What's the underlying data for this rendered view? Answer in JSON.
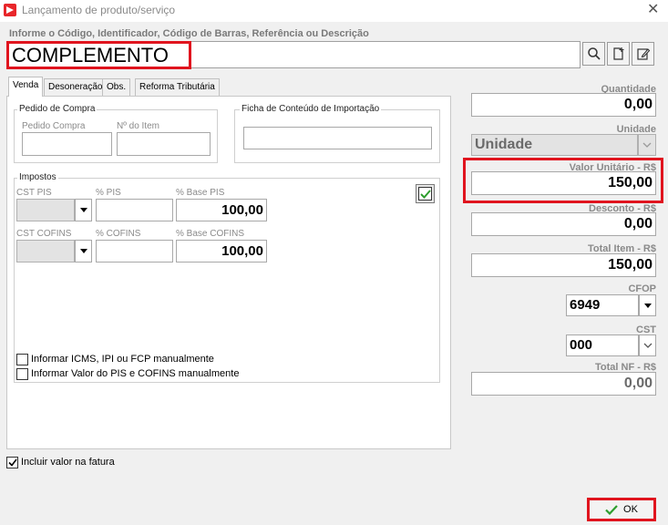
{
  "window": {
    "title": "Lançamento de produto/serviço"
  },
  "search": {
    "label": "Informe o Código, Identificador, Código de Barras, Referência ou Descrição",
    "value": "COMPLEMENTO"
  },
  "tabs": [
    {
      "label": "Venda",
      "active": true
    },
    {
      "label": "Desoneração",
      "active": false
    },
    {
      "label": "Obs.",
      "active": false
    },
    {
      "label": "Reforma Tributária",
      "active": false
    }
  ],
  "pedido_compra": {
    "title": "Pedido de Compra",
    "pedido_label": "Pedido Compra",
    "item_label": "Nº do Item",
    "pedido_value": "",
    "item_value": ""
  },
  "ficha": {
    "title": "Ficha de Conteúdo de Importação",
    "value": ""
  },
  "impostos": {
    "title": "Impostos",
    "cst_pis_label": "CST PIS",
    "pct_pis_label": "% PIS",
    "base_pis_label": "% Base PIS",
    "base_pis_value": "100,00",
    "cst_cofins_label": "CST COFINS",
    "pct_cofins_label": "% COFINS",
    "base_cofins_label": "% Base COFINS",
    "base_cofins_value": "100,00"
  },
  "checks": {
    "icms_manual": {
      "label": "Informar ICMS, IPI ou FCP manualmente",
      "checked": false
    },
    "pis_cofins_manual": {
      "label": "Informar Valor do PIS e COFINS manualmente",
      "checked": false
    },
    "incluir_fatura": {
      "label": "Incluir valor na fatura",
      "checked": true
    }
  },
  "right": {
    "quantidade_label": "Quantidade",
    "quantidade_value": "0,00",
    "unidade_label": "Unidade",
    "unidade_value": "Unidade",
    "valor_unitario_label": "Valor Unitário - R$",
    "valor_unitario_value": "150,00",
    "desconto_label": "Desconto - R$",
    "desconto_value": "0,00",
    "total_item_label": "Total Item - R$",
    "total_item_value": "150,00",
    "cfop_label": "CFOP",
    "cfop_value": "6949",
    "cst_label": "CST",
    "cst_value": "000",
    "total_nf_label": "Total NF - R$",
    "total_nf_value": "0,00"
  },
  "ok_button": {
    "label": "OK"
  },
  "colors": {
    "highlight": "#e0141e",
    "check_green": "#2e9e2e"
  }
}
